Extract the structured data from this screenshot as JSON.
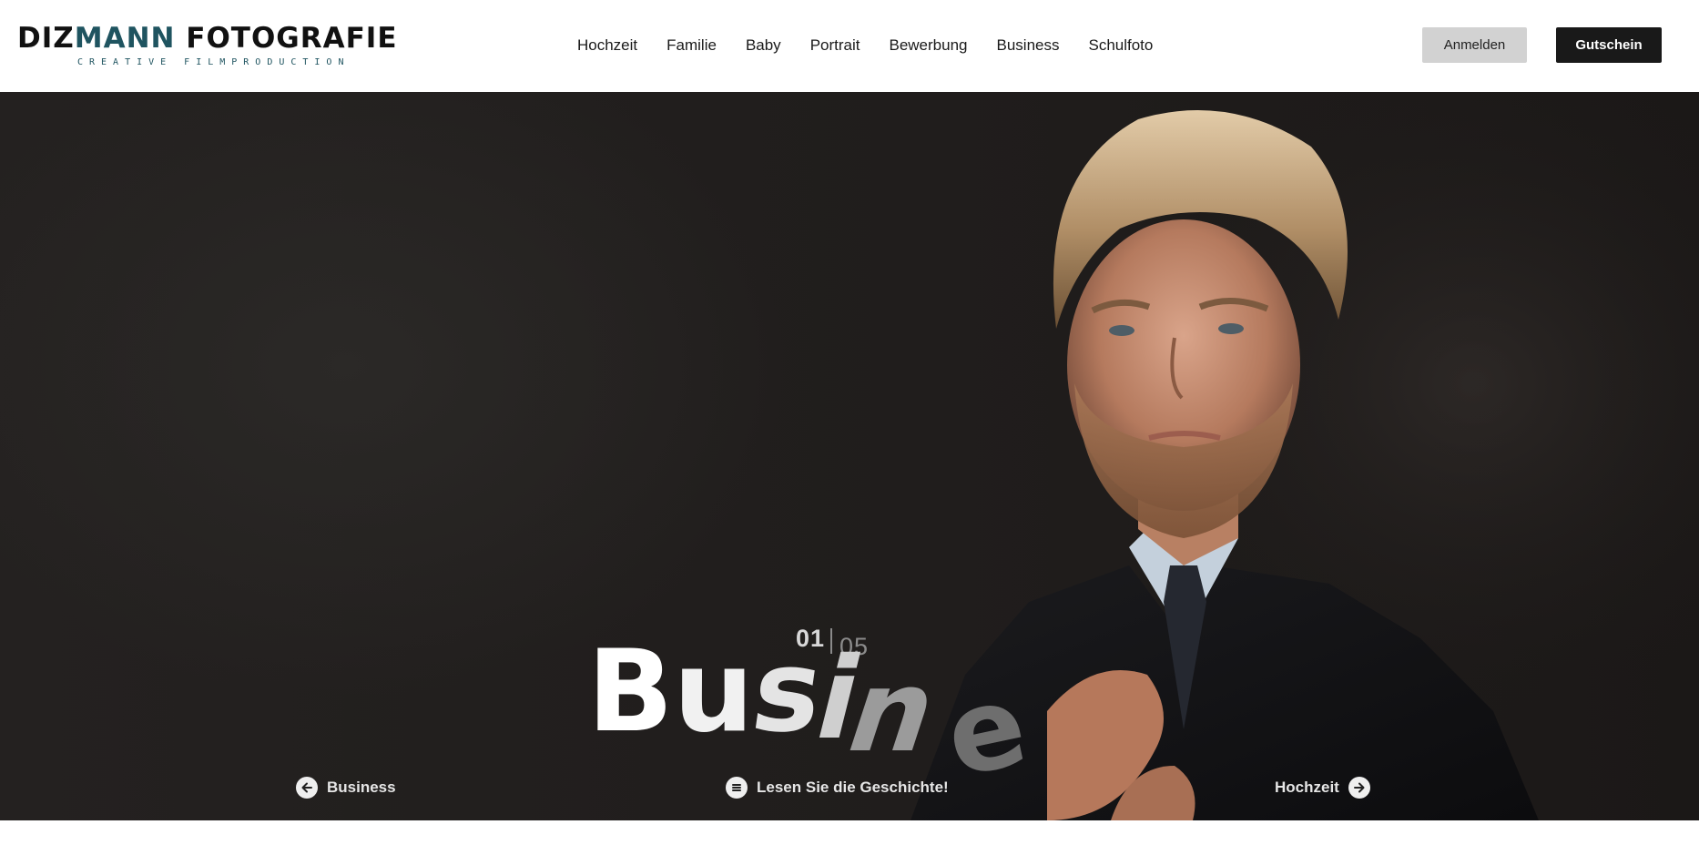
{
  "brand": {
    "name_a": "DIZ",
    "name_b": "MANN",
    "name_c": " FOTOGRAFIE",
    "tagline": "CREATIVE FILMPRODUCTION",
    "accent_color": "#1f5460"
  },
  "nav": {
    "items": [
      "Hochzeit",
      "Familie",
      "Baby",
      "Portrait",
      "Bewerbung",
      "Business",
      "Schulfoto"
    ]
  },
  "actions": {
    "login_label": "Anmelden",
    "voucher_label": "Gutschein"
  },
  "hero": {
    "slide_current": "01",
    "slide_total": "05",
    "title_letters": [
      "B",
      "u",
      "s",
      "i",
      "n",
      "e"
    ],
    "prev_label": "Business",
    "story_label": "Lesen Sie die Geschichte!",
    "next_label": "Hochzeit",
    "icons": {
      "prev": "arrow-left-icon",
      "story": "list-icon",
      "next": "arrow-right-icon"
    }
  }
}
